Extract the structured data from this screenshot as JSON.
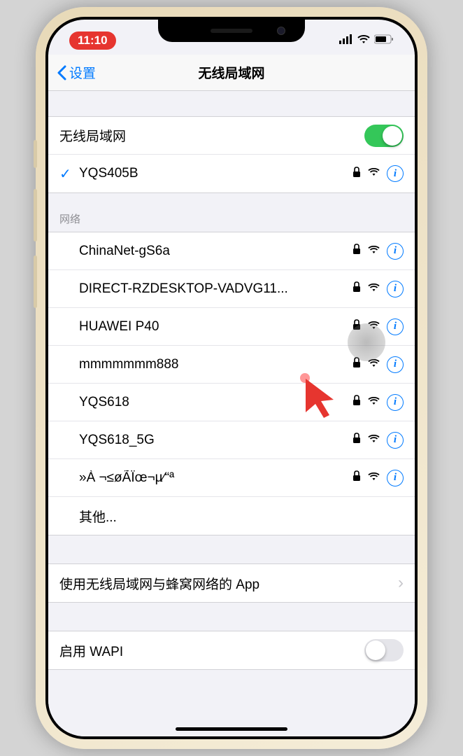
{
  "status": {
    "time": "11:10"
  },
  "nav": {
    "back": "设置",
    "title": "无线局域网"
  },
  "wifi": {
    "toggle_label": "无线局域网",
    "connected": "YQS405B",
    "section_label": "网络",
    "networks": [
      {
        "name": "ChinaNet-gS6a",
        "locked": true
      },
      {
        "name": "DIRECT-RZDESKTOP-VADVG11...",
        "locked": true
      },
      {
        "name": "HUAWEI P40",
        "locked": true
      },
      {
        "name": "mmmmmmm888",
        "locked": true
      },
      {
        "name": "YQS618",
        "locked": true
      },
      {
        "name": "YQS618_5G",
        "locked": true
      },
      {
        "name": "»À ¬≤øÃÏœ¬µ⁄“ª",
        "locked": true
      }
    ],
    "other": "其他..."
  },
  "apps_row": "使用无线局域网与蜂窝网络的 App",
  "wapi_label": "启用 WAPI"
}
